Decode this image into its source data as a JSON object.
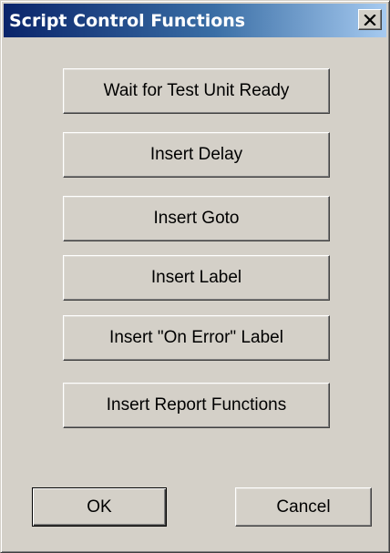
{
  "window": {
    "title": "Script Control Functions",
    "close_icon": "close-icon"
  },
  "functions": [
    {
      "label": "Wait for Test Unit Ready"
    },
    {
      "label": "Insert Delay"
    },
    {
      "label": "Insert Goto"
    },
    {
      "label": "Insert Label"
    },
    {
      "label": "Insert \"On Error\" Label"
    },
    {
      "label": "Insert Report Functions"
    }
  ],
  "footer": {
    "ok_label": "OK",
    "cancel_label": "Cancel"
  },
  "colors": {
    "dialog_face": "#d4d0c8",
    "titlebar_start": "#0a246a",
    "titlebar_end": "#a6caf0",
    "title_text": "#ffffff"
  }
}
